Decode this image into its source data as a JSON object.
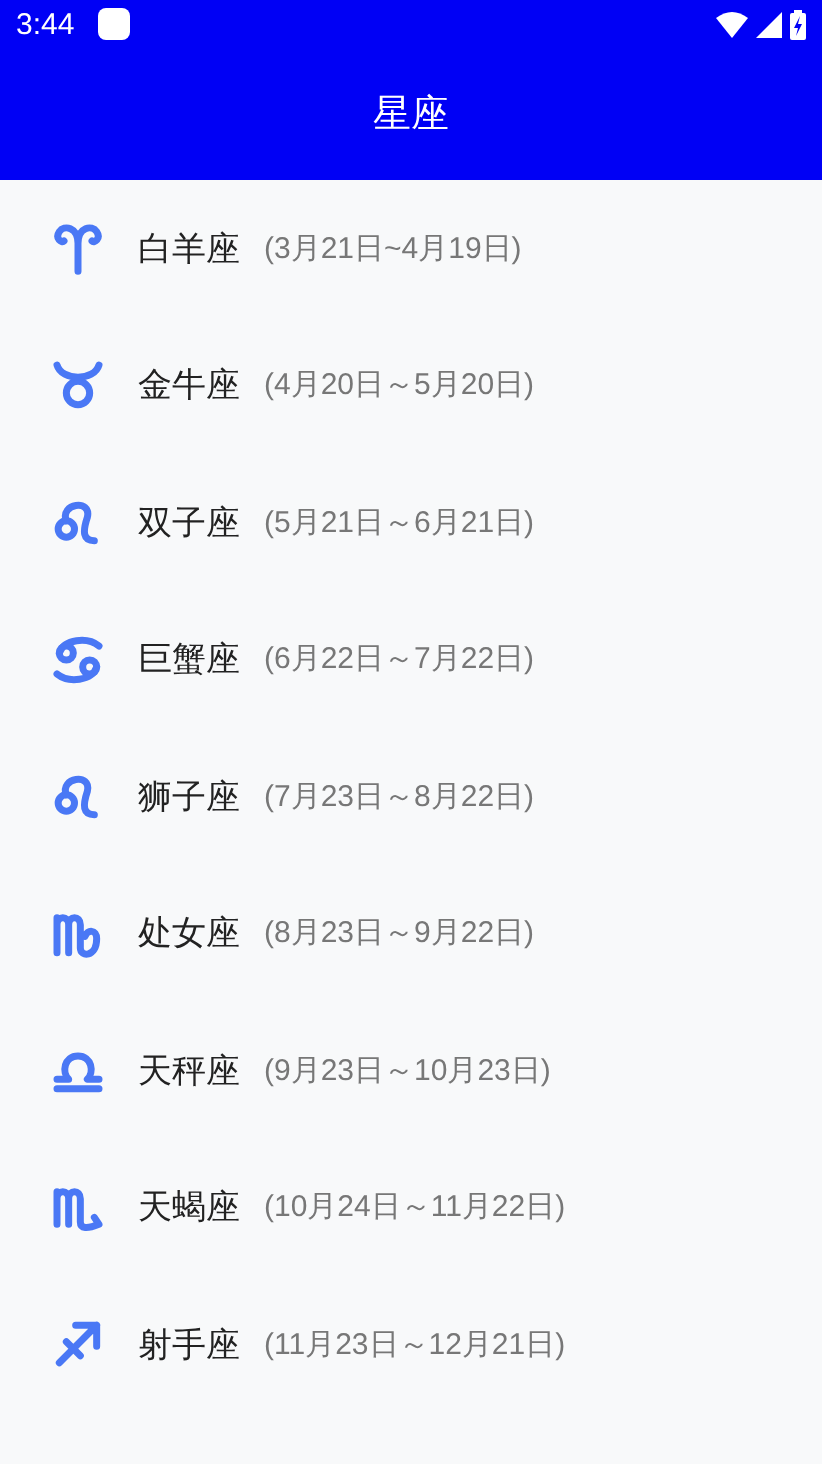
{
  "status_bar": {
    "time": "3:44"
  },
  "app_bar": {
    "title": "星座"
  },
  "signs": [
    {
      "name": "白羊座",
      "dates": "(3月21日~4月19日)"
    },
    {
      "name": "金牛座",
      "dates": "(4月20日～5月20日)"
    },
    {
      "name": "双子座",
      "dates": "(5月21日～6月21日)"
    },
    {
      "name": "巨蟹座",
      "dates": "(6月22日～7月22日)"
    },
    {
      "name": "狮子座",
      "dates": "(7月23日～8月22日)"
    },
    {
      "name": "处女座",
      "dates": "(8月23日～9月22日)"
    },
    {
      "name": "天秤座",
      "dates": "(9月23日～10月23日)"
    },
    {
      "name": "天蝎座",
      "dates": "(10月24日～11月22日)"
    },
    {
      "name": "射手座",
      "dates": "(11月23日～12月21日)"
    }
  ]
}
